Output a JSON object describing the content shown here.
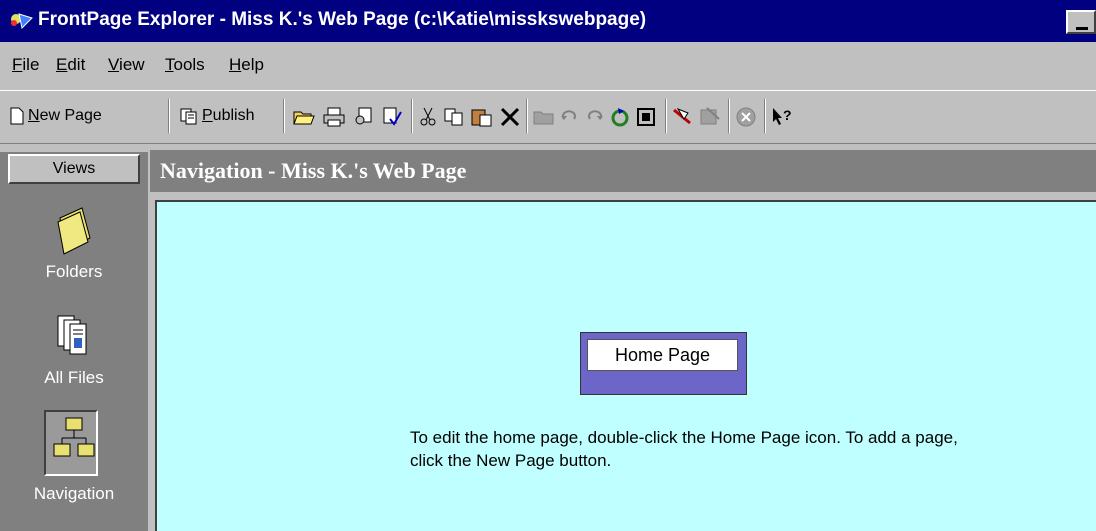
{
  "window": {
    "title": "FrontPage Explorer - Miss K.'s Web Page (c:\\Katie\\misskswebpage)"
  },
  "menu": {
    "items": [
      {
        "label": "File",
        "underline": "F"
      },
      {
        "label": "Edit",
        "underline": "E"
      },
      {
        "label": "View",
        "underline": "V"
      },
      {
        "label": "Tools",
        "underline": "T"
      },
      {
        "label": "Help",
        "underline": "H"
      }
    ]
  },
  "toolbar": {
    "new_page_label": "New Page",
    "publish_label": "Publish",
    "icons": [
      "open-icon",
      "print-icon",
      "find-icon",
      "spelling-icon",
      "cut-icon",
      "copy-icon",
      "paste-icon",
      "delete-icon",
      "folder-icon",
      "undo-icon",
      "redo-icon",
      "refresh-icon",
      "stop-icon",
      "editor-icon",
      "image-editor-icon",
      "cancel-icon",
      "help-icon"
    ]
  },
  "views": {
    "header": "Views",
    "items": [
      {
        "label": "Folders",
        "icon": "folder-icon"
      },
      {
        "label": "All Files",
        "icon": "all-files-icon"
      },
      {
        "label": "Navigation",
        "icon": "navigation-icon",
        "selected": true
      }
    ]
  },
  "pane": {
    "title": "Navigation - Miss K.'s Web Page"
  },
  "canvas": {
    "home_page_label": "Home Page",
    "instructions": "To edit the home page, double-click the Home Page icon.  To add a page, click the New Page button."
  },
  "colors": {
    "title_bar": "#000080",
    "canvas_bg": "#c0ffff",
    "home_box": "#6b66c8"
  }
}
